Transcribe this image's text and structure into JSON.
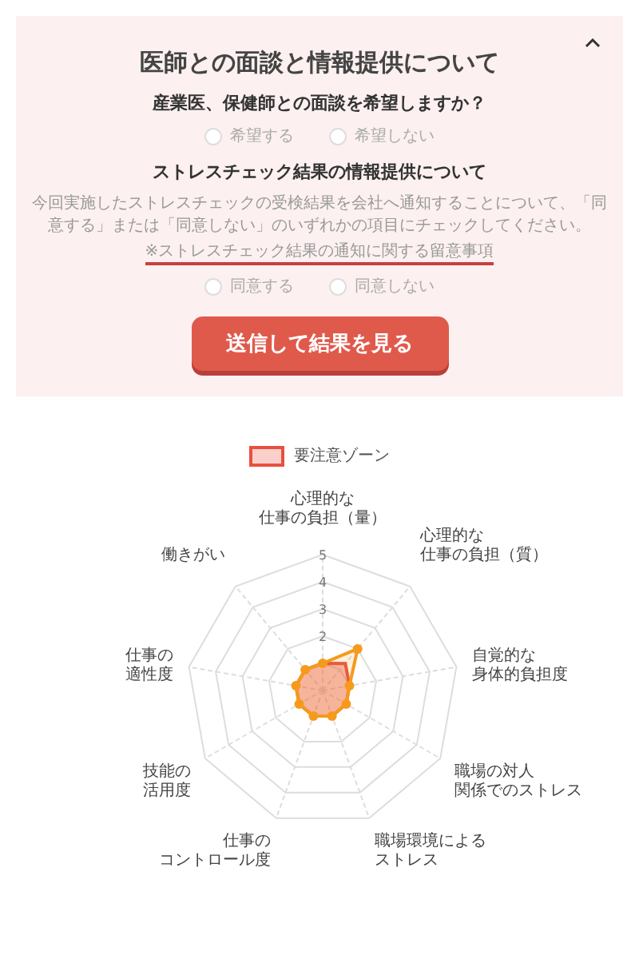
{
  "panel": {
    "expanded": true,
    "title": "医師との面談と情報提供について",
    "questions": [
      {
        "heading": "産業医、保健師との面談を希望しますか？",
        "options": [
          {
            "label": "希望する",
            "selected": false
          },
          {
            "label": "希望しない",
            "selected": false
          }
        ]
      },
      {
        "heading": "ストレスチェック結果の情報提供について",
        "note": "今回実施したストレスチェックの受検結果を会社へ通知することについて、「同意する」または「同意しない」のいずれかの項目にチェックしてください。",
        "link": "※ストレスチェック結果の通知に関する留意事項",
        "options": [
          {
            "label": "同意する",
            "selected": false
          },
          {
            "label": "同意しない",
            "selected": false
          }
        ]
      }
    ],
    "submit": "送信して結果を見る"
  },
  "radar": {
    "legend": {
      "label": "要注意ゾーン",
      "color": "#e8503f"
    },
    "ticks": [
      "5",
      "4",
      "3",
      "2"
    ],
    "axis_labels": [
      {
        "lines": [
          "心理的な",
          "仕事の負担（量）"
        ]
      },
      {
        "lines": [
          "働きがい"
        ]
      },
      {
        "lines": [
          "心理的な",
          "仕事の負担（質）"
        ]
      },
      {
        "lines": [
          "仕事の",
          "適性度"
        ]
      },
      {
        "lines": [
          "自覚的な",
          "身体的負担度"
        ]
      },
      {
        "lines": [
          "技能の",
          "活用度"
        ]
      },
      {
        "lines": [
          "職場の対人",
          "関係でのストレス"
        ]
      },
      {
        "lines": [
          "仕事の",
          "コントロール度"
        ]
      },
      {
        "lines": [
          "職場環境による",
          "ストレス"
        ]
      }
    ]
  }
}
